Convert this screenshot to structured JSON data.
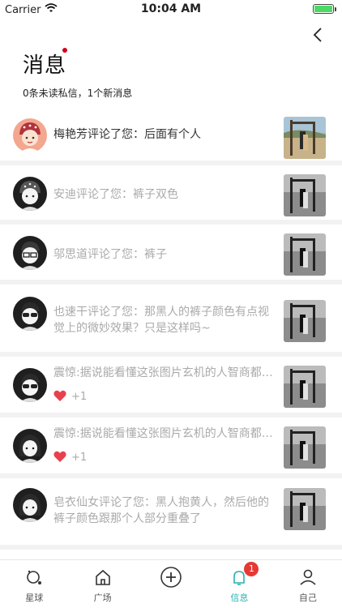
{
  "status_bar": {
    "carrier": "Carrier",
    "time": "10:04 AM"
  },
  "header": {
    "title": "消息",
    "summary": "0条未读私信，1个新消息"
  },
  "messages": [
    {
      "text": "梅艳芳评论了您：后面有个人",
      "unread": true,
      "likes": null
    },
    {
      "text": "安迪评论了您：裤子双色",
      "unread": false,
      "likes": null
    },
    {
      "text": "邬思道评论了您：裤子",
      "unread": false,
      "likes": null
    },
    {
      "text": "也速干评论了您：那黑人的裤子颜色有点视觉上的微妙效果？只是这样吗~",
      "unread": false,
      "likes": null
    },
    {
      "text": "震惊:据说能看懂这张图片玄机的人智商都很高",
      "unread": false,
      "likes": "+1"
    },
    {
      "text": "震惊:据说能看懂这张图片玄机的人智商都很高",
      "unread": false,
      "likes": "+1"
    },
    {
      "text": "皂衣仙女评论了您：黑人抱黄人，然后他的裤子颜色跟那个人部分重叠了",
      "unread": false,
      "likes": null
    }
  ],
  "tabs": [
    {
      "label": "星球",
      "icon": "planet-icon",
      "active": false,
      "badge": null
    },
    {
      "label": "广场",
      "icon": "home-icon",
      "active": false,
      "badge": null
    },
    {
      "label": "",
      "icon": "plus-circle-icon",
      "active": false,
      "badge": null
    },
    {
      "label": "信息",
      "icon": "bell-icon",
      "active": true,
      "badge": "1"
    },
    {
      "label": "自己",
      "icon": "user-icon",
      "active": false,
      "badge": null
    }
  ],
  "colors": {
    "accent": "#27b3b0",
    "badge": "#e53935",
    "like": "#e8414e",
    "unread_dot": "#d0021b"
  }
}
